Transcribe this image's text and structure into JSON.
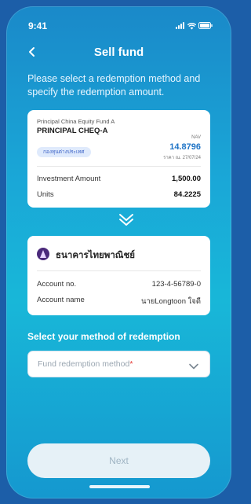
{
  "status": {
    "time": "9:41"
  },
  "header": {
    "title": "Sell fund",
    "back_icon": "chevron-left-icon"
  },
  "instruction": "Please select a redemption method and specify the redemption amount.",
  "fund": {
    "subtitle": "Principal China Equity Fund A",
    "name": "PRINCIPAL CHEQ-A",
    "tag": "กองทุนต่างประเทศ",
    "nav_label": "NAV",
    "nav_value": "14.8796",
    "nav_date": "ราคา ณ. 27/07/24",
    "rows": [
      {
        "label": "Investment Amount",
        "value": "1,500.00"
      },
      {
        "label": "Units",
        "value": "84.2225"
      }
    ]
  },
  "bank": {
    "name": "ธนาคารไทยพาณิชย์",
    "rows": [
      {
        "label": "Account no.",
        "value": "123-4-56789-0"
      },
      {
        "label": "Account name",
        "value": "นายLongtoon ใจดี"
      }
    ]
  },
  "redemption": {
    "section_title": "Select your method of redemption",
    "placeholder": "Fund redemption method",
    "required_mark": "*"
  },
  "next_button": {
    "label": "Next"
  },
  "colors": {
    "accent": "#1f74c6",
    "required": "#e53935",
    "tag_bg": "#dfeafc"
  }
}
